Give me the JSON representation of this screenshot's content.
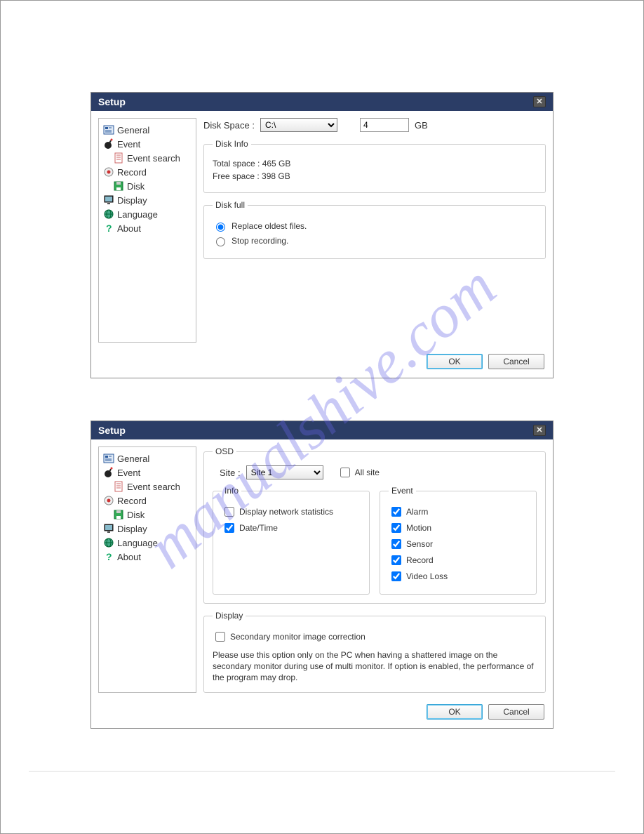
{
  "watermark": "manualshive.com",
  "dialog1": {
    "title": "Setup",
    "nav": {
      "general": "General",
      "event": "Event",
      "event_search": "Event search",
      "record": "Record",
      "disk": "Disk",
      "display": "Display",
      "language": "Language",
      "about": "About"
    },
    "disk_space_label": "Disk Space :",
    "drive_selected": "C:\\",
    "gb_value": "4",
    "gb_unit": "GB",
    "disk_info": {
      "legend": "Disk Info",
      "total": "Total space : 465 GB",
      "free": "Free space : 398 GB"
    },
    "disk_full": {
      "legend": "Disk full",
      "replace": "Replace oldest files.",
      "stop": "Stop recording."
    },
    "ok": "OK",
    "cancel": "Cancel"
  },
  "dialog2": {
    "title": "Setup",
    "nav": {
      "general": "General",
      "event": "Event",
      "event_search": "Event search",
      "record": "Record",
      "disk": "Disk",
      "display": "Display",
      "language": "Language",
      "about": "About"
    },
    "osd": {
      "legend": "OSD",
      "site_label": "Site :",
      "site_selected": "Site 1",
      "all_site": "All site",
      "info": {
        "legend": "Info",
        "net_stats": "Display network statistics",
        "datetime": "Date/Time"
      },
      "event": {
        "legend": "Event",
        "alarm": "Alarm",
        "motion": "Motion",
        "sensor": "Sensor",
        "record": "Record",
        "video_loss": "Video Loss"
      }
    },
    "display": {
      "legend": "Display",
      "secondary": "Secondary monitor image correction",
      "hint": "Please use this option only on the PC when having a shattered image on the secondary monitor during use of multi monitor. If option is enabled, the performance of the program may drop."
    },
    "ok": "OK",
    "cancel": "Cancel"
  }
}
